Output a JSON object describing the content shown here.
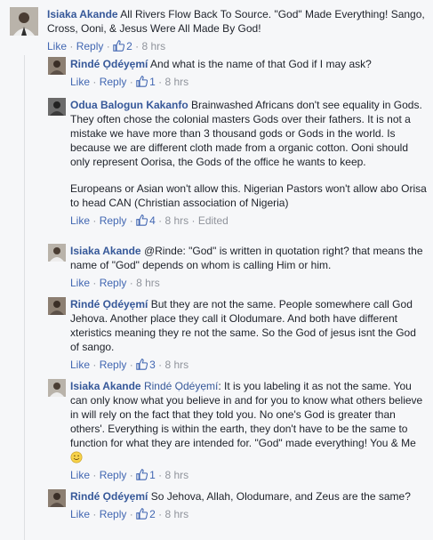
{
  "comments": [
    {
      "author": "Isiaka Akande",
      "text": "All Rivers Flow Back To Source. \"God\" Made Everything! Sango, Cross, Ooni, & Jesus Were All Made By God!",
      "like": "Like",
      "reply": "Reply",
      "likes": "2",
      "time": "8 hrs"
    },
    {
      "author": "Rindé Ọdéyẹmí",
      "text": "And what is the name of that God if I may ask?",
      "like": "Like",
      "reply": "Reply",
      "likes": "1",
      "time": "8 hrs"
    },
    {
      "author": "Odua Balogun Kakanfo",
      "text": "Brainwashed Africans don't see equality in Gods. They often chose the colonial masters Gods over their fathers. It is not a mistake we have more than 3 thousand gods or Gods in the world. Is because we are different cloth made from a organic cotton. Ooni should only represent Oorisa, the Gods of the office he wants to keep.",
      "text2": "Europeans or Asian won't allow this. Nigerian Pastors won't allow abo Orisa to head CAN (Christian association of Nigeria)",
      "like": "Like",
      "reply": "Reply",
      "likes": "4",
      "time": "8 hrs",
      "edited": "Edited"
    },
    {
      "author": "Isiaka Akande",
      "text": "@Rinde: \"God\" is written in quotation right? that means the name of \"God\" depends on whom is calling Him or him.",
      "like": "Like",
      "reply": "Reply",
      "time": "8 hrs"
    },
    {
      "author": "Rindé Ọdéyẹmí",
      "text": "But they are not the same. People somewhere call God Jehova. Another place they call it Olodumare. And both have different xteristics meaning they re not the same. So the God of jesus isnt the God of sango.",
      "like": "Like",
      "reply": "Reply",
      "likes": "3",
      "time": "8 hrs"
    },
    {
      "author": "Isiaka Akande",
      "mention": "Rindé Ọdéyẹmí",
      "text": ": It is you labeling it as not the same. You can only know what you believe in and for you to know what others believe in will rely on the fact that they told you. No one's God is greater than others'. Everything is within the earth, they don't have to be the same to function for what they are intended for. \"God\" made everything! You & Me",
      "like": "Like",
      "reply": "Reply",
      "likes": "1",
      "time": "8 hrs"
    },
    {
      "author": "Rindé Ọdéyẹmí",
      "text": "So Jehova, Allah, Olodumare, and Zeus are the same?",
      "like": "Like",
      "reply": "Reply",
      "likes": "2",
      "time": "8 hrs"
    }
  ],
  "icons": {
    "thumb": "thumbs-up-icon",
    "smile": "smile-emoji-icon"
  },
  "colors": {
    "link": "#365899",
    "meta": "#90949c",
    "action": "#4267b2",
    "background": "#f6f7f9"
  }
}
